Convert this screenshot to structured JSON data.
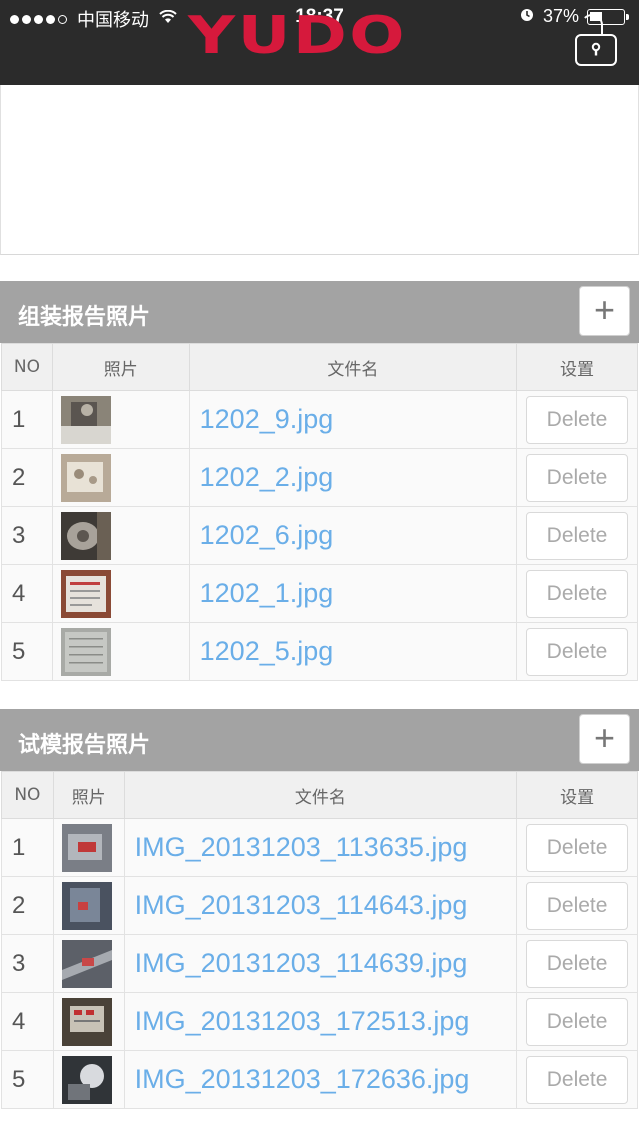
{
  "status_bar": {
    "carrier": "中国移动",
    "time": "18:37",
    "battery": "37%",
    "battery_level": 0.37,
    "icons": [
      "signal-dots",
      "wifi-icon",
      "alarm-icon",
      "battery-icon"
    ]
  },
  "header": {
    "logo": "YUDO",
    "logo_color": "#d6193c",
    "lock_icon": "lock-icon"
  },
  "sections": [
    {
      "title": "组装报告照片",
      "add_label": "+",
      "columns": [
        "NO",
        "照片",
        "文件名",
        "设置"
      ],
      "rows": [
        {
          "no": "1",
          "file": "1202_9.jpg",
          "action": "Delete"
        },
        {
          "no": "2",
          "file": "1202_2.jpg",
          "action": "Delete"
        },
        {
          "no": "3",
          "file": "1202_6.jpg",
          "action": "Delete"
        },
        {
          "no": "4",
          "file": "1202_1.jpg",
          "action": "Delete"
        },
        {
          "no": "5",
          "file": "1202_5.jpg",
          "action": "Delete"
        }
      ]
    },
    {
      "title": "试模报告照片",
      "add_label": "+",
      "columns": [
        "NO",
        "照片",
        "文件名",
        "设置"
      ],
      "rows": [
        {
          "no": "1",
          "file": "IMG_20131203_113635.jpg",
          "action": "Delete"
        },
        {
          "no": "2",
          "file": "IMG_20131203_114643.jpg",
          "action": "Delete"
        },
        {
          "no": "3",
          "file": "IMG_20131203_114639.jpg",
          "action": "Delete"
        },
        {
          "no": "4",
          "file": "IMG_20131203_172513.jpg",
          "action": "Delete"
        },
        {
          "no": "5",
          "file": "IMG_20131203_172636.jpg",
          "action": "Delete"
        }
      ]
    }
  ],
  "colors": {
    "header_bg": "#2b2b2b",
    "section_bg": "#a3a3a3",
    "link": "#6aaee8"
  }
}
